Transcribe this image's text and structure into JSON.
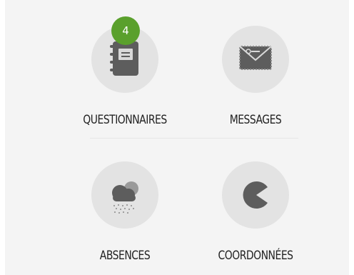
{
  "menu": {
    "items": [
      {
        "label": "QUESTIONNAIRES",
        "icon": "notebook-icon",
        "badge": "4"
      },
      {
        "label": "MESSAGES",
        "icon": "envelope-icon"
      },
      {
        "label": "ABSENCES",
        "icon": "snow-cloud-icon"
      },
      {
        "label": "COORDONNÉES",
        "icon": "pacman-icon"
      }
    ]
  },
  "colors": {
    "background": "#f4f4f4",
    "icon_circle": "#e3e3e3",
    "icon": "#5d5d5d",
    "badge": "#5aa02c",
    "label": "#222222"
  }
}
